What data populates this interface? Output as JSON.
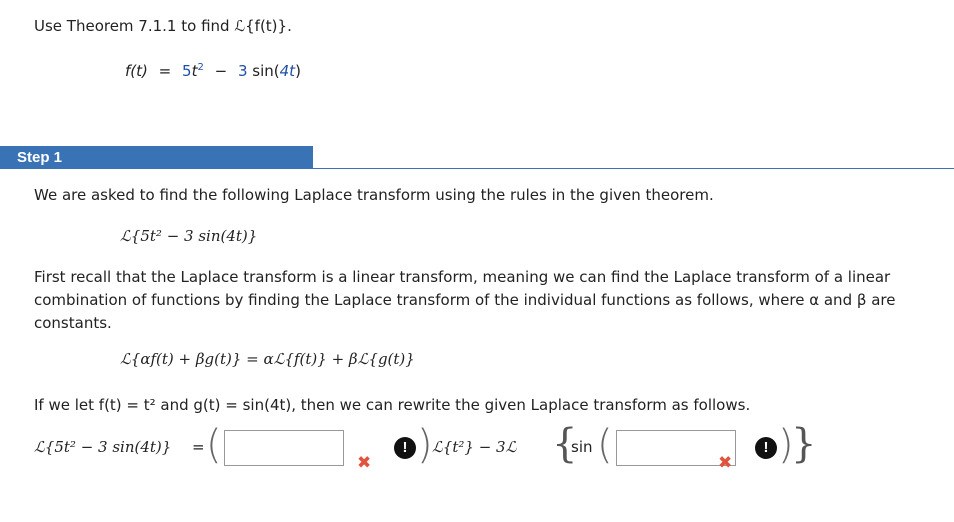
{
  "problem": {
    "prompt": "Use Theorem 7.1.1 to find ℒ{f(t)}.",
    "fn_lhs": "f(t)",
    "fn_coef1": "5",
    "fn_t": "t",
    "fn_exp": "2",
    "fn_minus": "−",
    "fn_coef2": "3",
    "fn_sin": "sin(",
    "fn_arg": "4t",
    "fn_close": ")"
  },
  "step": {
    "label": "Step 1",
    "intro": "We are asked to find the following Laplace transform using the rules in the given theorem.",
    "transform": "ℒ{5t² − 3 sin(4t)}",
    "linear_text": "First recall that the Laplace transform is a linear transform, meaning we can find the Laplace transform of a linear combination of functions by finding the Laplace transform of the individual functions as follows, where α and β are constants.",
    "linearity_rule": "ℒ{αf(t) + βg(t)} = αℒ{f(t)} + βℒ{g(t)}",
    "let_text": "If we let f(t) = t² and g(t) = sin(4t), then we can rewrite the given Laplace transform as follows.",
    "answer_lhs": "ℒ{5t² − 3 sin(4t)}",
    "answer_eq": "=",
    "mid_term": "ℒ{t²} − 3ℒ",
    "sin_label": "sin",
    "input1_value": "",
    "input2_value": ""
  },
  "icons": {
    "incorrect": "x-mark-icon",
    "info": "info-icon"
  },
  "colors": {
    "step_header": "#3a72b6",
    "incorrect": "#e0533e",
    "number_blue": "#1f4fa8"
  }
}
